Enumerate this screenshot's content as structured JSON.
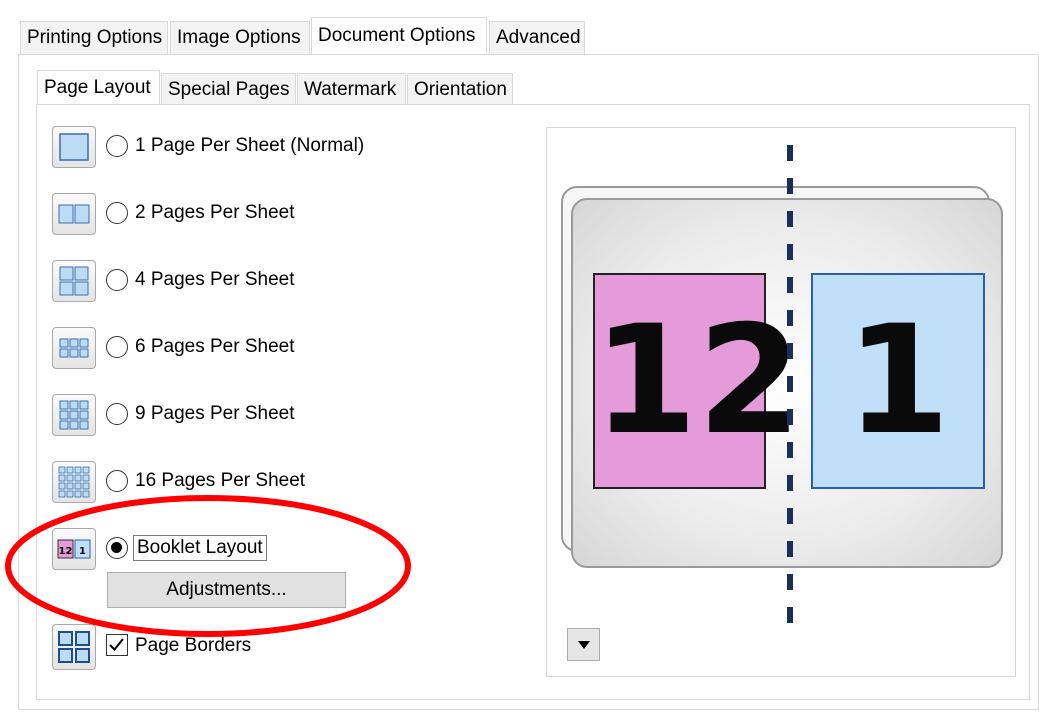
{
  "top_tabs": [
    "Printing Options",
    "Image Options",
    "Document Options",
    "Advanced"
  ],
  "sub_tabs": [
    "Page Layout",
    "Special Pages",
    "Watermark",
    "Orientation"
  ],
  "layout_options": [
    {
      "label": "1 Page Per Sheet (Normal)",
      "icon": "1-page-per-sheet-icon",
      "selected": false
    },
    {
      "label": "2 Pages Per Sheet",
      "icon": "2-pages-per-sheet-icon",
      "selected": false
    },
    {
      "label": "4 Pages Per Sheet",
      "icon": "4-pages-per-sheet-icon",
      "selected": false
    },
    {
      "label": "6 Pages Per Sheet",
      "icon": "6-pages-per-sheet-icon",
      "selected": false
    },
    {
      "label": "9 Pages Per Sheet",
      "icon": "9-pages-per-sheet-icon",
      "selected": false
    },
    {
      "label": "16 Pages Per Sheet",
      "icon": "16-pages-per-sheet-icon",
      "selected": false
    },
    {
      "label": "Booklet Layout",
      "icon": "booklet-layout-icon",
      "selected": true
    }
  ],
  "adjustments_label": "Adjustments...",
  "page_borders": {
    "label": "Page Borders",
    "checked": true
  },
  "preview": {
    "left_page": "12",
    "right_page": "1",
    "left_color": "#e59ad9",
    "right_color": "#bfe0f8"
  },
  "icon_numbers": {
    "left": "12",
    "right": "1"
  },
  "dropdown_icon": "triangle-down-icon",
  "highlight_color": "#ff0000"
}
